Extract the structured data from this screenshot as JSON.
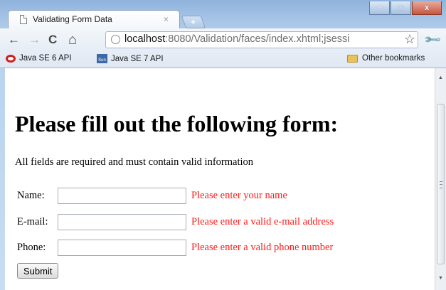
{
  "browser": {
    "tab": {
      "title": "Validating Form Data",
      "close_glyph": "×",
      "icon": "page-icon"
    },
    "new_tab_glyph": "+",
    "window_controls": {
      "minimize": "–",
      "maximize": "□",
      "close": "x"
    },
    "nav": {
      "back": "←",
      "forward": "→",
      "reload": "C",
      "home": "⌂"
    },
    "address": {
      "host": "localhost",
      "rest": ":8080/Validation/faces/index.xhtml;jsessi",
      "star": "☆"
    },
    "menu_glyph": "🔧",
    "bookmarks": [
      {
        "label": "Java SE 6 API",
        "icon": "oracle-icon"
      },
      {
        "label": "Java SE 7 API",
        "icon": "sun-icon"
      }
    ],
    "other_bookmarks": "Other bookmarks",
    "sun_icon_text": "Sun"
  },
  "page": {
    "heading": "Please fill out the following form:",
    "intro": "All fields are required and must contain valid information",
    "fields": [
      {
        "label": "Name:",
        "value": "",
        "error": "Please enter your name"
      },
      {
        "label": "E-mail:",
        "value": "",
        "error": "Please enter a valid e-mail address"
      },
      {
        "label": "Phone:",
        "value": "",
        "error": "Please enter a valid phone number"
      }
    ],
    "submit_label": "Submit"
  },
  "colors": {
    "error": "#ff1a1a",
    "frame": "#a9c6e8"
  }
}
